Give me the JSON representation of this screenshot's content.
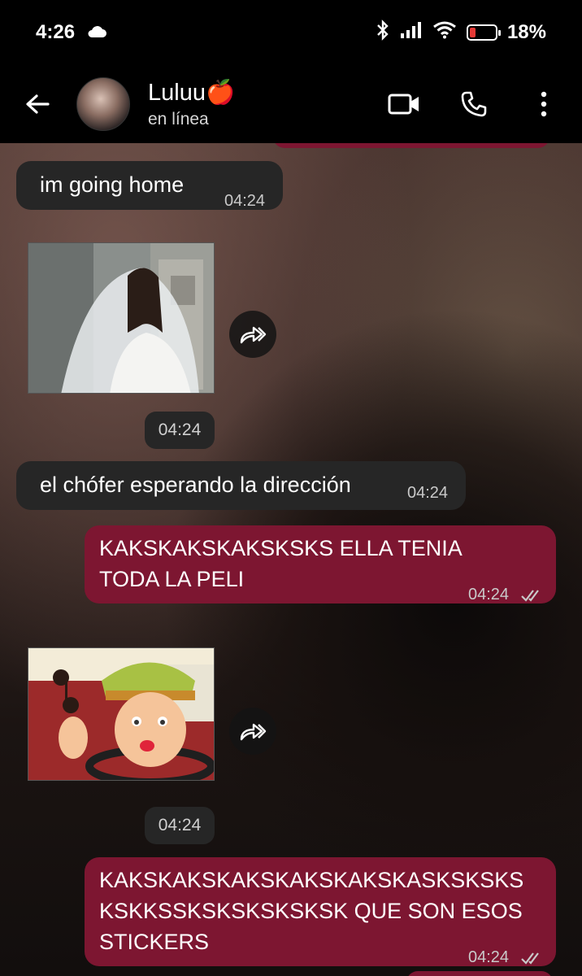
{
  "status_bar": {
    "time": "4:26",
    "battery_percent": "18%",
    "battery_level": 0.18
  },
  "header": {
    "contact_name": "Luluu🍎",
    "contact_status": "en línea",
    "icons": [
      "back-arrow-icon",
      "video-call-icon",
      "phone-icon",
      "more-vert-icon"
    ]
  },
  "messages": [
    {
      "type": "received_text",
      "text": "im going home",
      "time": "04:24"
    },
    {
      "type": "received_image",
      "subject": "bride-photo",
      "time": "04:24"
    },
    {
      "type": "received_text",
      "text": "el chófer esperando la dirección",
      "time": "04:24"
    },
    {
      "type": "sent_text",
      "lines": [
        "KAKSKAKSKAKSKSKS ELLA TENIA",
        "TODA LA PELI"
      ],
      "time": "04:24",
      "status": "read"
    },
    {
      "type": "received_image",
      "subject": "cartoon-sticker",
      "time": "04:24"
    },
    {
      "type": "sent_text",
      "lines": [
        "KAKSKAKSKAKSKAKSKAKSKASKSKSKS",
        "KSKKSSKSKSKSKSKSK QUE SON ESOS",
        "STICKERS"
      ],
      "time": "04:24",
      "status": "read"
    }
  ],
  "colors": {
    "sent_bubble": "#7d1631",
    "received_bubble": "#262626",
    "battery_low": "#e53935"
  }
}
